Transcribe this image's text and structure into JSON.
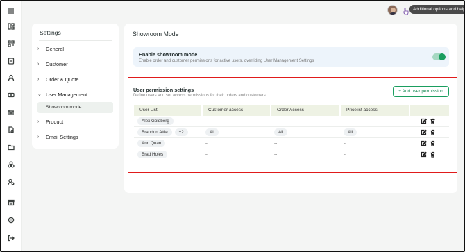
{
  "topbar": {
    "tooltip": "Additional options and help.",
    "dots": "⋯"
  },
  "settings": {
    "title": "Settings",
    "items": [
      {
        "label": "General",
        "chevron": "›"
      },
      {
        "label": "Customer",
        "chevron": "›"
      },
      {
        "label": "Order & Quote",
        "chevron": "›"
      },
      {
        "label": "User Management",
        "chevron": "⌄"
      },
      {
        "label": "Product",
        "chevron": "›"
      },
      {
        "label": "Email Settings",
        "chevron": "›"
      }
    ],
    "sub_item": "Showroom mode"
  },
  "main": {
    "title": "Showroom Mode",
    "showroom": {
      "heading": "Enable showroom mode",
      "description": "Enable order and customer permissions for active users, overriding User Management Settings",
      "enabled": true
    },
    "permissions": {
      "title": "User permission settings",
      "subtitle": "Define users and set access permissions for their orders and customers.",
      "add_button": "+ Add user permission",
      "columns": [
        "User List",
        "Customer access",
        "Order Access",
        "Pricelist access"
      ],
      "rows": [
        {
          "user": "Alex Goldberg",
          "extra": "",
          "customer": "--",
          "order": "--",
          "pricelist": "--"
        },
        {
          "user": "Brandon Attie",
          "extra": "+2",
          "customer": "All",
          "order": "All",
          "pricelist": "All"
        },
        {
          "user": "Ann Quan",
          "extra": "",
          "customer": "--",
          "order": "--",
          "pricelist": "--"
        },
        {
          "user": "Brad Holes",
          "extra": "",
          "customer": "--",
          "order": "--",
          "pricelist": "--"
        }
      ]
    }
  },
  "colors": {
    "accent": "#1a9e5f",
    "highlight": "#e01b1b",
    "header_bg": "#eef2e4"
  }
}
